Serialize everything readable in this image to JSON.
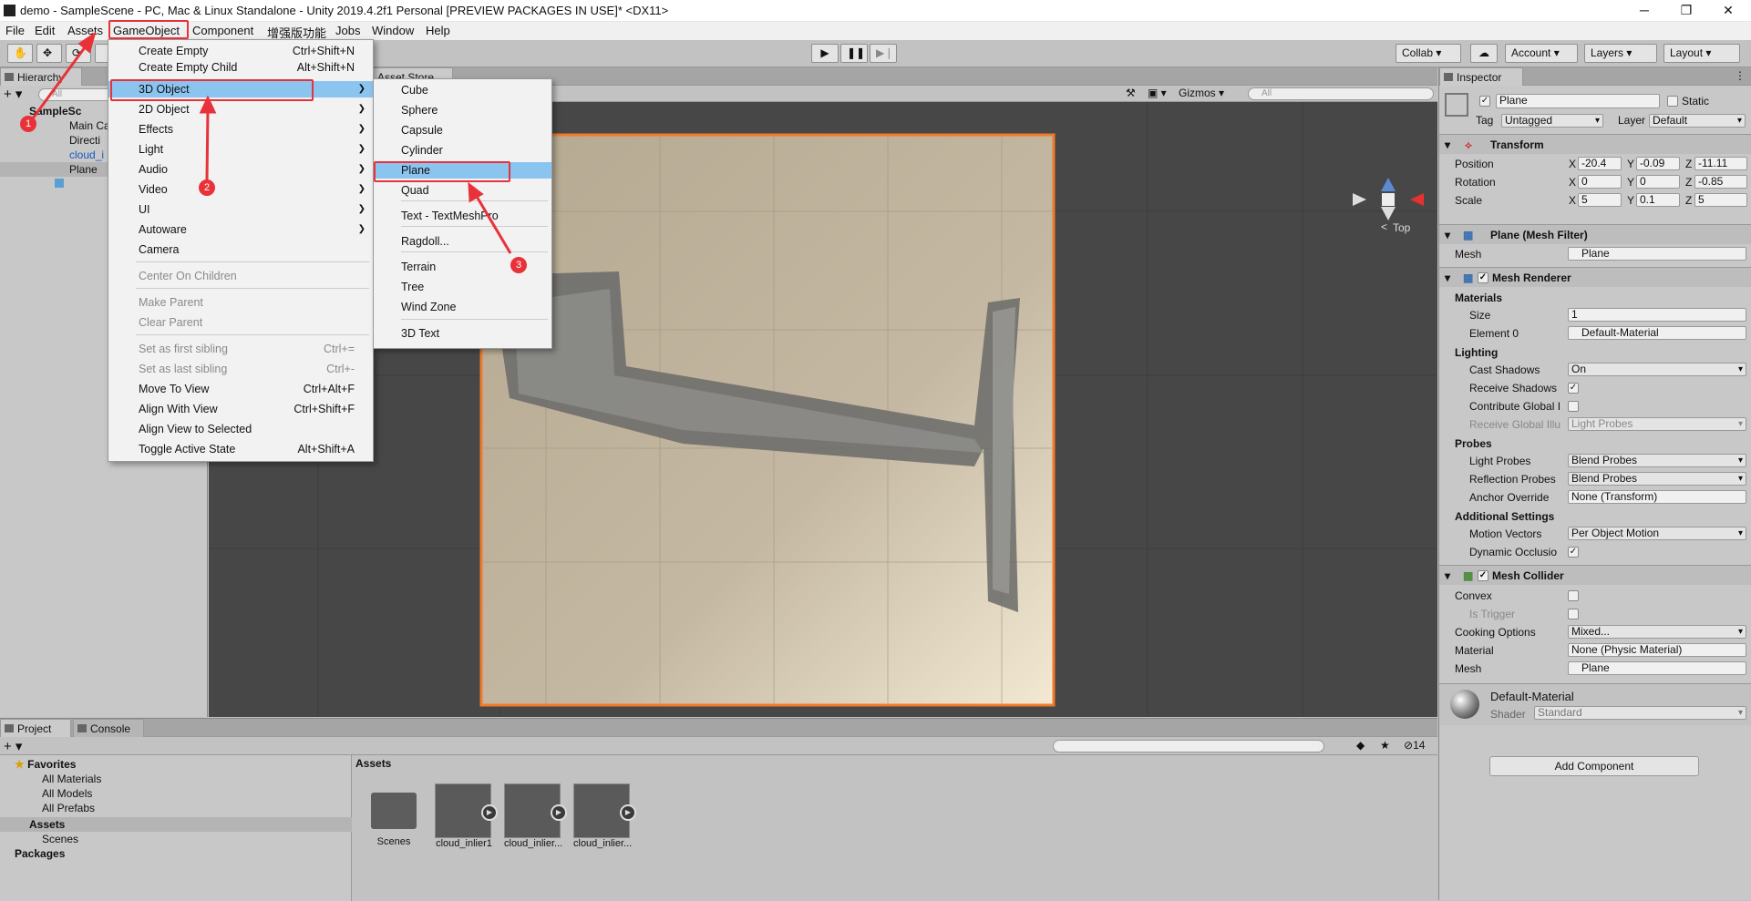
{
  "window": {
    "title": "demo - SampleScene - PC, Mac & Linux Standalone - Unity 2019.4.2f1 Personal [PREVIEW PACKAGES IN USE]* <DX11>",
    "minimize": "─",
    "maximize": "❐",
    "close": "✕"
  },
  "menubar": [
    "File",
    "Edit",
    "Assets",
    "GameObject",
    "Component",
    "增强版功能",
    "Jobs",
    "Window",
    "Help"
  ],
  "toolbar": {
    "collab": "Collab",
    "account": "Account",
    "layers": "Layers",
    "layout": "Layout"
  },
  "hierarchy": {
    "tab": "Hierarchy",
    "search_placeholder": "All",
    "items": [
      "SampleSc",
      "Main Ca",
      "Directi",
      "cloud_i",
      "Plane"
    ]
  },
  "scene": {
    "tab_asset_store": "Asset Store",
    "gizmos": "Gizmos",
    "search_placeholder": "All",
    "view_label": "Top"
  },
  "gameobject_menu": {
    "items": [
      {
        "label": "Create Empty",
        "shortcut": "Ctrl+Shift+N"
      },
      {
        "label": "Create Empty Child",
        "shortcut": "Alt+Shift+N"
      },
      {
        "label": "3D Object",
        "shortcut": ""
      },
      {
        "label": "2D Object",
        "shortcut": ""
      },
      {
        "label": "Effects",
        "shortcut": ""
      },
      {
        "label": "Light",
        "shortcut": ""
      },
      {
        "label": "Audio",
        "shortcut": ""
      },
      {
        "label": "Video",
        "shortcut": ""
      },
      {
        "label": "UI",
        "shortcut": ""
      },
      {
        "label": "Autoware",
        "shortcut": ""
      },
      {
        "label": "Camera",
        "shortcut": ""
      },
      {
        "label": "Center On Children",
        "shortcut": ""
      },
      {
        "label": "Make Parent",
        "shortcut": ""
      },
      {
        "label": "Clear Parent",
        "shortcut": ""
      },
      {
        "label": "Set as first sibling",
        "shortcut": "Ctrl+="
      },
      {
        "label": "Set as last sibling",
        "shortcut": "Ctrl+-"
      },
      {
        "label": "Move To View",
        "shortcut": "Ctrl+Alt+F"
      },
      {
        "label": "Align With View",
        "shortcut": "Ctrl+Shift+F"
      },
      {
        "label": "Align View to Selected",
        "shortcut": ""
      },
      {
        "label": "Toggle Active State",
        "shortcut": "Alt+Shift+A"
      }
    ]
  },
  "submenu_3d": {
    "items": [
      "Cube",
      "Sphere",
      "Capsule",
      "Cylinder",
      "Plane",
      "Quad",
      "Text - TextMeshPro",
      "Ragdoll...",
      "Terrain",
      "Tree",
      "Wind Zone",
      "3D Text"
    ]
  },
  "annotations": [
    "1",
    "2",
    "3"
  ],
  "inspector": {
    "tab": "Inspector",
    "object_name": "Plane",
    "static_label": "Static",
    "tag_label": "Tag",
    "tag_value": "Untagged",
    "layer_label": "Layer",
    "layer_value": "Default",
    "transform": {
      "title": "Transform",
      "position_label": "Position",
      "pos_x": "-20.4",
      "pos_y": "-0.09",
      "pos_z": "-11.11",
      "rotation_label": "Rotation",
      "rot_x": "0",
      "rot_y": "0",
      "rot_z": "-0.85",
      "scale_label": "Scale",
      "scale_x": "5",
      "scale_y": "0.1",
      "scale_z": "5"
    },
    "mesh_filter": {
      "title": "Plane (Mesh Filter)",
      "mesh_label": "Mesh",
      "mesh_value": "Plane"
    },
    "mesh_renderer": {
      "title": "Mesh Renderer",
      "materials": "Materials",
      "size_label": "Size",
      "size_value": "1",
      "element0_label": "Element 0",
      "element0_value": "Default-Material",
      "lighting": "Lighting",
      "cast_shadows_label": "Cast Shadows",
      "cast_shadows_value": "On",
      "receive_shadows_label": "Receive Shadows",
      "contribute_gi_label": "Contribute Global I",
      "receive_gi_label": "Receive Global Illu",
      "receive_gi_value": "Light Probes",
      "probes": "Probes",
      "light_probes_label": "Light Probes",
      "light_probes_value": "Blend Probes",
      "reflection_probes_label": "Reflection Probes",
      "reflection_probes_value": "Blend Probes",
      "anchor_override_label": "Anchor Override",
      "anchor_override_value": "None (Transform)",
      "additional_settings": "Additional Settings",
      "motion_vectors_label": "Motion Vectors",
      "motion_vectors_value": "Per Object Motion",
      "dynamic_occlusion_label": "Dynamic Occlusio"
    },
    "mesh_collider": {
      "title": "Mesh Collider",
      "convex_label": "Convex",
      "is_trigger_label": "Is Trigger",
      "cooking_options_label": "Cooking Options",
      "cooking_options_value": "Mixed...",
      "material_label": "Material",
      "material_value": "None (Physic Material)",
      "mesh_label": "Mesh",
      "mesh_value": "Plane"
    },
    "material": {
      "name": "Default-Material",
      "shader_label": "Shader",
      "shader_value": "Standard"
    },
    "add_component": "Add Component"
  },
  "project": {
    "tab_project": "Project",
    "tab_console": "Console",
    "count": "14",
    "favorites": "Favorites",
    "favorite_items": [
      "All Materials",
      "All Models",
      "All Prefabs"
    ],
    "assets": "Assets",
    "assets_children": [
      "Scenes"
    ],
    "packages": "Packages",
    "breadcrumb": "Assets",
    "asset_items": [
      "Scenes",
      "cloud_inlier1",
      "cloud_inlier...",
      "cloud_inlier..."
    ]
  },
  "colors": {
    "highlight": "#8cc4f0",
    "annotation_red": "#e8323a",
    "selection_outline": "#f07a2a"
  }
}
